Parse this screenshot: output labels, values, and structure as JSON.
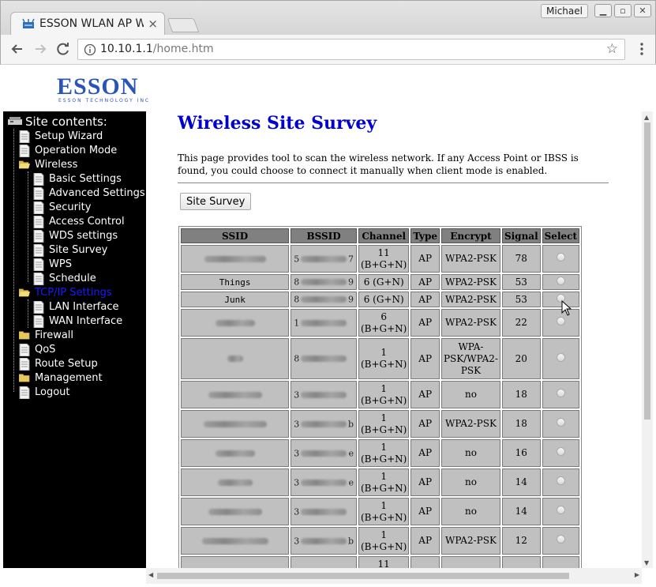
{
  "browser": {
    "tab_title": "ESSON WLAN AP W",
    "tab_close": "×",
    "profile": "Michael",
    "url_host": "10.10.1.1",
    "url_path": "/home.htm",
    "star": "☆"
  },
  "logo": {
    "wordmark": "ESSON",
    "tagline": "ESSON TECHNOLOGY INC"
  },
  "sidebar": {
    "title": "Site contents:",
    "items": [
      {
        "label": "Setup Wizard",
        "icon": "page-icon"
      },
      {
        "label": "Operation Mode",
        "icon": "page-icon"
      },
      {
        "label": "Wireless",
        "icon": "folder-open-icon"
      },
      {
        "label": "Basic Settings",
        "icon": "page-icon"
      },
      {
        "label": "Advanced Settings",
        "icon": "page-icon"
      },
      {
        "label": "Security",
        "icon": "page-icon"
      },
      {
        "label": "Access Control",
        "icon": "page-icon"
      },
      {
        "label": "WDS settings",
        "icon": "page-icon"
      },
      {
        "label": "Site Survey",
        "icon": "page-icon"
      },
      {
        "label": "WPS",
        "icon": "page-icon"
      },
      {
        "label": "Schedule",
        "icon": "page-icon"
      },
      {
        "label": "TCP/IP Settings",
        "icon": "folder-open-icon"
      },
      {
        "label": "LAN Interface",
        "icon": "page-icon"
      },
      {
        "label": "WAN Interface",
        "icon": "page-icon"
      },
      {
        "label": "Firewall",
        "icon": "folder-icon"
      },
      {
        "label": "QoS",
        "icon": "page-icon"
      },
      {
        "label": "Route Setup",
        "icon": "page-icon"
      },
      {
        "label": "Management",
        "icon": "folder-icon"
      },
      {
        "label": "Logout",
        "icon": "page-icon"
      }
    ]
  },
  "main": {
    "title": "Wireless Site Survey",
    "description": "This page provides tool to scan the wireless network. If any Access Point or IBSS is found, you could choose to connect it manually when client mode is enabled.",
    "button_label": "Site Survey"
  },
  "table": {
    "headers": [
      "SSID",
      "BSSID",
      "Channel",
      "Type",
      "Encrypt",
      "Signal",
      "Select"
    ],
    "rows": [
      {
        "ssid": "",
        "bssid_first": "5",
        "bssid_last": "7",
        "channel": [
          "11",
          "(B+G+N)"
        ],
        "type": "AP",
        "encrypt": "WPA2-PSK",
        "signal": "78"
      },
      {
        "ssid": "Things",
        "bssid_first": "8",
        "bssid_last": "9",
        "channel": [
          "6 (G+N)"
        ],
        "type": "AP",
        "encrypt": "WPA2-PSK",
        "signal": "53"
      },
      {
        "ssid": "Junk",
        "bssid_first": "8",
        "bssid_last": "9",
        "channel": [
          "6 (G+N)"
        ],
        "type": "AP",
        "encrypt": "WPA2-PSK",
        "signal": "53"
      },
      {
        "ssid": "",
        "bssid_first": "1",
        "bssid_last": "",
        "channel": [
          "6",
          "(B+G+N)"
        ],
        "type": "AP",
        "encrypt": "WPA2-PSK",
        "signal": "22"
      },
      {
        "ssid": "",
        "bssid_first": "8",
        "bssid_last": "",
        "channel": [
          "1",
          "(B+G+N)"
        ],
        "type": "AP",
        "encrypt": "WPA-PSK/WPA2-PSK",
        "signal": "20"
      },
      {
        "ssid": "",
        "bssid_first": "3",
        "bssid_last": "",
        "channel": [
          "1",
          "(B+G+N)"
        ],
        "type": "AP",
        "encrypt": "no",
        "signal": "18"
      },
      {
        "ssid": "",
        "bssid_first": "3",
        "bssid_last": "b",
        "channel": [
          "1",
          "(B+G+N)"
        ],
        "type": "AP",
        "encrypt": "WPA2-PSK",
        "signal": "18"
      },
      {
        "ssid": "",
        "bssid_first": "3",
        "bssid_last": "e",
        "channel": [
          "1",
          "(B+G+N)"
        ],
        "type": "AP",
        "encrypt": "no",
        "signal": "16"
      },
      {
        "ssid": "",
        "bssid_first": "3",
        "bssid_last": "e",
        "channel": [
          "1",
          "(B+G+N)"
        ],
        "type": "AP",
        "encrypt": "no",
        "signal": "14"
      },
      {
        "ssid": "",
        "bssid_first": "3",
        "bssid_last": "",
        "channel": [
          "1",
          "(B+G+N)"
        ],
        "type": "AP",
        "encrypt": "no",
        "signal": "14"
      },
      {
        "ssid": "",
        "bssid_first": "3",
        "bssid_last": "b",
        "channel": [
          "1",
          "(B+G+N)"
        ],
        "type": "AP",
        "encrypt": "WPA2-PSK",
        "signal": "12"
      },
      {
        "ssid": "",
        "bssid_first": "",
        "bssid_last": "",
        "channel": [
          "11"
        ],
        "type": "",
        "encrypt": "",
        "signal": ""
      }
    ]
  },
  "colors": {
    "sidebar_bg": "#000000",
    "sidebar_text": "#ffffff",
    "sidebar_active": "#1a1aff",
    "title_blue": "#0000cc",
    "header_cell": "#808080",
    "body_cell": "#c0c0c0"
  }
}
